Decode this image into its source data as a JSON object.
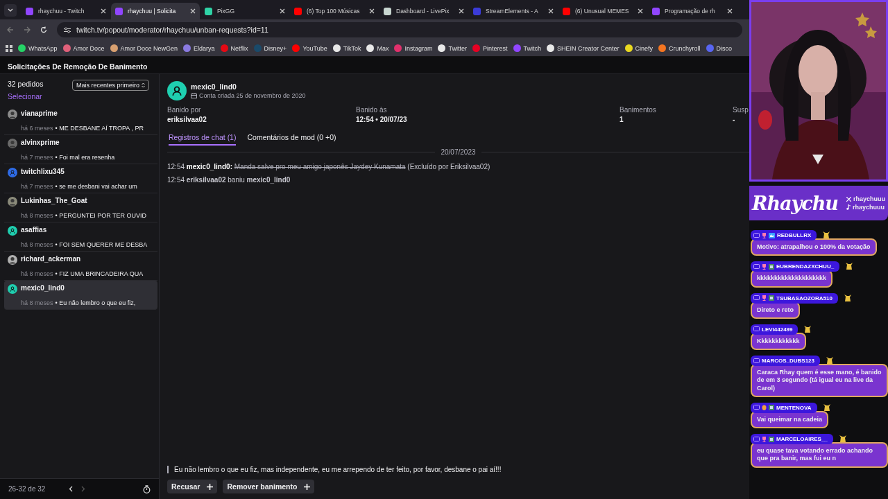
{
  "browser": {
    "tabs": [
      {
        "label": "rhaychuu - Twitch",
        "selected": false,
        "color": "#9146ff"
      },
      {
        "label": "rhaychuu | Solicita",
        "selected": true,
        "color": "#9146ff"
      },
      {
        "label": "PixGG",
        "selected": false,
        "color": "#2fd3a6"
      },
      {
        "label": "(6) Top 100 Músicas",
        "selected": false,
        "color": "#ff0000"
      },
      {
        "label": "Dashboard - LivePix",
        "selected": false,
        "color": "#c8d6d0"
      },
      {
        "label": "StreamElements - A",
        "selected": false,
        "color": "#3b3bd8"
      },
      {
        "label": "(6) Unusual MEMES",
        "selected": false,
        "color": "#ff0000"
      },
      {
        "label": "Programação de rh",
        "selected": false,
        "color": "#9146ff"
      }
    ],
    "url": "twitch.tv/popout/moderator/rhaychuu/unban-requests?id=11",
    "bookmarks": [
      {
        "label": "WhatsApp",
        "color": "#25d366"
      },
      {
        "label": "Amor Doce",
        "color": "#e0607a"
      },
      {
        "label": "Amor Doce NewGen",
        "color": "#d8a070"
      },
      {
        "label": "Eldarya",
        "color": "#8a7ae0"
      },
      {
        "label": "Netflix",
        "color": "#e50914"
      },
      {
        "label": "Disney+",
        "color": "#1a4a6a"
      },
      {
        "label": "YouTube",
        "color": "#ff0000"
      },
      {
        "label": "TikTok",
        "color": "#e8e8e8"
      },
      {
        "label": "Max",
        "color": "#e8e8e8"
      },
      {
        "label": "Instagram",
        "color": "#e1306c"
      },
      {
        "label": "Twitter",
        "color": "#e8e8e8"
      },
      {
        "label": "Pinterest",
        "color": "#e60023"
      },
      {
        "label": "Twitch",
        "color": "#9146ff"
      },
      {
        "label": "SHEIN Creator Center",
        "color": "#e8e8e8"
      },
      {
        "label": "Cinefy",
        "color": "#e8d820"
      },
      {
        "label": "Crunchyroll",
        "color": "#f47521"
      },
      {
        "label": "Disco",
        "color": "#5865f2"
      }
    ]
  },
  "page": {
    "title": "Solicitações De Remoção De Banimento",
    "count": "32 pedidos",
    "sort": "Mais recentes primeiro",
    "select_link": "Selecionar",
    "requests": [
      {
        "user": "vianaprime",
        "time": "há 6 meses",
        "message": "• ME DESBANE AÍ TROPA , PR",
        "selected": false,
        "color": "#8a8a8a"
      },
      {
        "user": "alvinxprime",
        "time": "há 7 meses",
        "message": "• Foi mal era resenha",
        "selected": false,
        "color": "#6a6a6a"
      },
      {
        "user": "twitchlixu345",
        "time": "há 7 meses",
        "message": "• se me desbani vai achar um",
        "selected": false,
        "kind": "default",
        "color": "#2e6be6"
      },
      {
        "user": "Lukinhas_The_Goat",
        "time": "há 8 meses",
        "message": "• PERGUNTEI POR TER OUVID",
        "selected": false,
        "color": "#8a8a7a"
      },
      {
        "user": "asaffias",
        "time": "há 8 meses",
        "message": "• FOI SEM QUERER ME DESBA",
        "selected": false,
        "kind": "default",
        "color": "#1fcfb0"
      },
      {
        "user": "richard_ackerman",
        "time": "há 8 meses",
        "message": "• FIZ UMA BRINCADEIRA QUA",
        "selected": false,
        "color": "#b0b0b0"
      },
      {
        "user": "mexic0_lind0",
        "time": "há 8 meses",
        "message": "• Eu não lembro o que eu fiz,",
        "selected": true,
        "kind": "default",
        "color": "#1fcfb0"
      }
    ],
    "pagination": "26-32 de 32",
    "detail": {
      "user": "mexic0_lind0",
      "created": "Conta criada 25 de novembro de 2020",
      "color": "#1fcfb0",
      "stats": [
        {
          "label": "Banido por",
          "value": "eriksilvaa02"
        },
        {
          "label": "Banido às",
          "value": "12:54 • 20/07/23"
        },
        {
          "label": "Banimentos",
          "value": "1"
        },
        {
          "label": "Susp",
          "value": "-"
        }
      ],
      "tabs": [
        {
          "label": "Registros de chat (1)",
          "selected": true
        },
        {
          "label": "Comentários de mod (0 +0)",
          "selected": false
        }
      ],
      "date": "20/07/2023",
      "log": [
        {
          "kind": "message",
          "time": "12:54",
          "user": "mexic0_lind0:",
          "text": "Manda salve pro meu amigo japonês Jaydey Kunamata",
          "deleted": true,
          "note": "(Excluído por Eriksilvaa02)"
        },
        {
          "kind": "event",
          "time": "12:54",
          "text": "**eriksilvaa02** baniu **mexic0_lind0**"
        }
      ],
      "request_text": "Eu não lembro o que eu fiz, mas independente, eu me arrependo de ter feito, por favor, desbane o pai aí!!!",
      "buttons": [
        "Recusar",
        "Remover banimento"
      ]
    }
  },
  "overlay": {
    "logo": "Rhaychu",
    "socials": [
      {
        "kind": "x",
        "handle": "rhaychuuu"
      },
      {
        "kind": "tiktok",
        "handle": "rhaychuuu"
      }
    ],
    "chat": [
      {
        "name": "REDBULLRX",
        "badges": [
          {
            "kind": "chat"
          },
          {
            "kind": "cheer"
          },
          {
            "kind": "crown"
          }
        ],
        "text": "Motivo: atrapalhou o 100% da votação"
      },
      {
        "name": "EUBRENDAZXCHUU_",
        "badges": [
          {
            "kind": "chat"
          },
          {
            "kind": "cheer"
          },
          {
            "kind": "sub"
          }
        ],
        "text": "kkkkkkkkkkkkkkkkkkkk"
      },
      {
        "name": "TSUBASAOZORA510",
        "badges": [
          {
            "kind": "chat"
          },
          {
            "kind": "cheer"
          },
          {
            "kind": "sub"
          }
        ],
        "text": "Direto e reto"
      },
      {
        "name": "LEVI442499",
        "badges": [
          {
            "kind": "chat"
          }
        ],
        "text": "Kkkkkkkkkkkk"
      },
      {
        "name": "MARCOS_DUBS123",
        "badges": [
          {
            "kind": "chat"
          }
        ],
        "text": "Caraca Rhay quem é esse mano, é banido de em 3 segundo (tá igual eu na live da Carol)"
      },
      {
        "name": "MENTENOVA",
        "badges": [
          {
            "kind": "chat"
          },
          {
            "kind": "egg"
          },
          {
            "kind": "sub"
          }
        ],
        "text": "Vai queimar na cadeia"
      },
      {
        "name": "MARCELOAIRES__",
        "badges": [
          {
            "kind": "chat"
          },
          {
            "kind": "cheer"
          },
          {
            "kind": "sub"
          }
        ],
        "text": "eu quase tava votando errado achando que pra banir, mas fui eu n"
      }
    ]
  }
}
